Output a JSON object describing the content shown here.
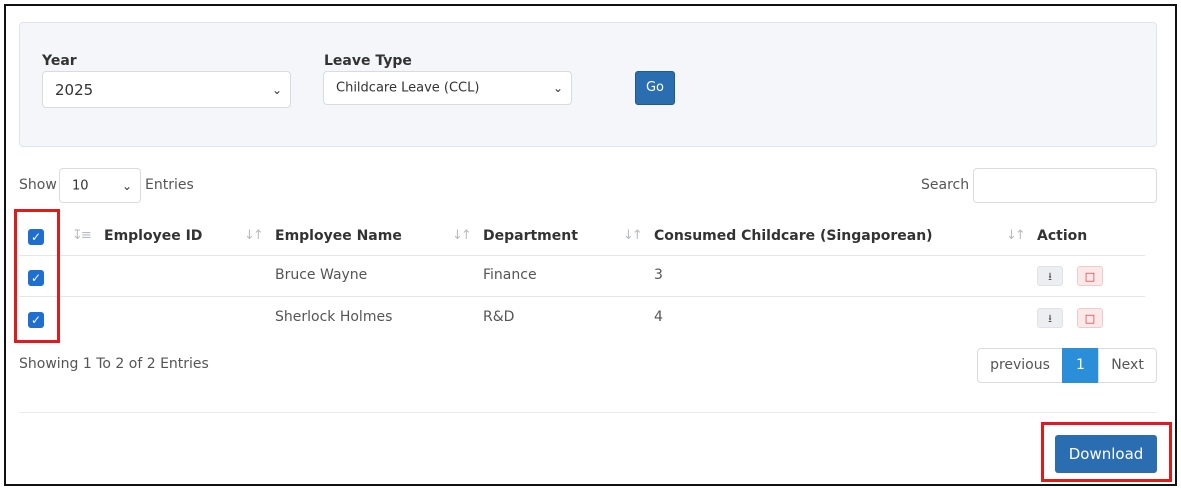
{
  "filters": {
    "year_label": "Year",
    "year_value": "2025",
    "leave_type_label": "Leave Type",
    "leave_type_value": "Childcare Leave (CCL)",
    "go_label": "Go"
  },
  "table_controls": {
    "show_label": "Show",
    "entries_value": "10",
    "entries_label": "Entries",
    "search_label": "Search",
    "search_value": ""
  },
  "table": {
    "columns": [
      "Employee ID",
      "Employee Name",
      "Department",
      "Consumed Childcare (Singaporean)",
      "Action"
    ],
    "select_all_checked": true,
    "rows": [
      {
        "checked": true,
        "employee_id": "",
        "employee_name": "Bruce Wayne",
        "department": "Finance",
        "consumed": "3"
      },
      {
        "checked": true,
        "employee_id": "",
        "employee_name": "Sherlock Holmes",
        "department": "R&D",
        "consumed": "4"
      }
    ],
    "action_icons": [
      "download-icon",
      "pdf-icon"
    ]
  },
  "pagination": {
    "info": "Showing 1 To 2 of 2 Entries",
    "previous_label": "previous",
    "current_page": "1",
    "next_label": "Next"
  },
  "footer": {
    "download_label": "Download"
  },
  "colors": {
    "primary_button": "#2a6db0",
    "checkbox": "#1f6fd0",
    "active_page": "#2a8fd8",
    "highlight": "#e01b1b",
    "pdf_icon": "#d9262b"
  }
}
